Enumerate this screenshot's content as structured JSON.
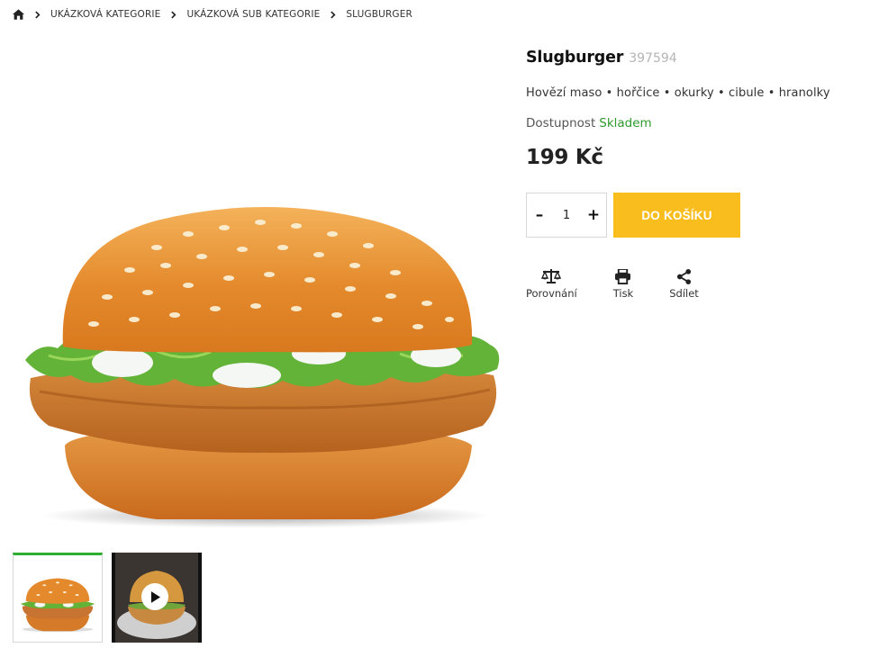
{
  "breadcrumb": {
    "home_icon": "home-icon",
    "items": [
      "UKÁZKOVÁ KATEGORIE",
      "UKÁZKOVÁ SUB KATEGORIE"
    ],
    "current": "SLUGBURGER"
  },
  "product": {
    "title": "Slugburger",
    "code": "397594",
    "ingredients": "Hovězí maso • hořčice • okurky • cibule • hranolky",
    "availability_label": "Dostupnost",
    "availability_value": "Skladem",
    "price": "199 Kč",
    "quantity": "1",
    "add_to_cart": "DO KOŠÍKU"
  },
  "actions": {
    "compare": "Porovnání",
    "print": "Tisk",
    "share": "Sdílet"
  },
  "colors": {
    "accent": "#f9bd1e",
    "in_stock": "#2e9a2e",
    "active_thumb": "#2eae2e"
  }
}
